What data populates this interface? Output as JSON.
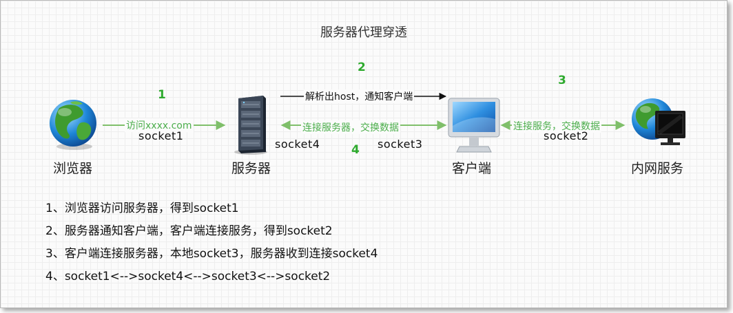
{
  "diagram": {
    "title": "服务器代理穿透",
    "nodes": {
      "browser": {
        "label": "浏览器",
        "icon": "globe-icon"
      },
      "server": {
        "label": "服务器",
        "icon": "server-rack-icon"
      },
      "client": {
        "label": "客户端",
        "icon": "desktop-monitor-icon"
      },
      "intranet": {
        "label": "内网服务",
        "icon": "globe-with-monitor-icon"
      }
    },
    "steps": [
      "1",
      "2",
      "3",
      "4"
    ],
    "edges": {
      "browser_server": "访问xxxx.com",
      "server_client_top": "解析出host，通知客户端",
      "server_client_bottom": "连接服务器，交换数据",
      "client_intranet": "连接服务，交换数据"
    },
    "sockets": {
      "s1": "socket1",
      "s2": "socket2",
      "s3": "socket3",
      "s4": "socket4"
    },
    "notes": [
      "1、浏览器访问服务器，得到socket1",
      "2、服务器通知客户端，客户端连接服务，得到socket2",
      "3、客户端连接服务器，本地socket3，服务器收到连接socket4",
      "4、socket1<-->socket4<-->socket3<-->socket2"
    ],
    "colors": {
      "green_line": "#7fbf6a",
      "step_green": "#2eaa2e",
      "black_line": "#111111"
    }
  }
}
